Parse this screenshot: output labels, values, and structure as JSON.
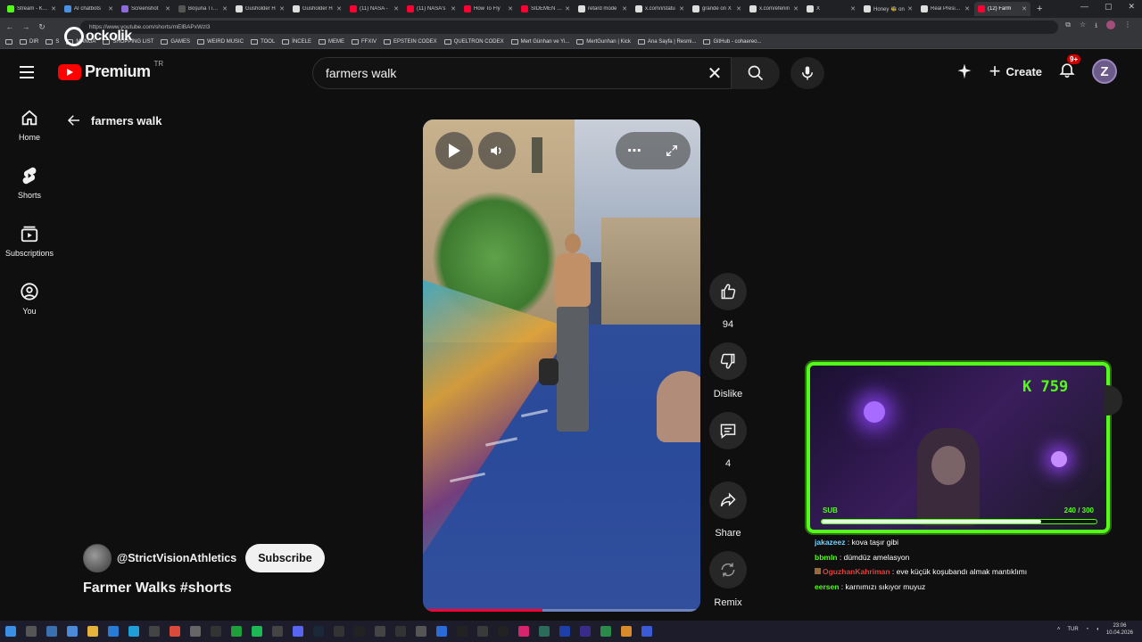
{
  "browser": {
    "tabs": [
      {
        "label": "Stream - Kick",
        "color": "#53fc18"
      },
      {
        "label": "AI chatbots",
        "color": "#4a90e2"
      },
      {
        "label": "Screenshot",
        "color": "#8e6bd8"
      },
      {
        "label": "Boşuna Tıklan",
        "color": "#555555"
      },
      {
        "label": "Gusholder H",
        "color": "#dddddd"
      },
      {
        "label": "Gusholder H",
        "color": "#dddddd"
      },
      {
        "label": "(11) NASA -",
        "color": "#ff0033"
      },
      {
        "label": "(11) NASA's",
        "color": "#ff0033"
      },
      {
        "label": "How To Fly",
        "color": "#ff0033"
      },
      {
        "label": "SIDEMEN CH",
        "color": "#ff0033"
      },
      {
        "label": "retard mode",
        "color": "#dddddd"
      },
      {
        "label": "x.com/i/statu",
        "color": "#dddddd"
      },
      {
        "label": "grande on X",
        "color": "#dddddd"
      },
      {
        "label": "x.com/efenin",
        "color": "#dddddd"
      },
      {
        "label": "X",
        "color": "#dddddd"
      },
      {
        "label": "Honey 🐝 on",
        "color": "#dddddd"
      },
      {
        "label": "Real Presiden",
        "color": "#dddddd"
      },
      {
        "label": "(12) Farm",
        "color": "#ff0033",
        "active": true
      }
    ],
    "url": "https://www.youtube.com/shorts/mElBAPxWzl3",
    "bookmarks": [
      "DIR",
      "S",
      "MANGA",
      "SHOPPING LIST",
      "GAMES",
      "WEIRD MUSIC",
      "TOOL",
      "İNCELE",
      "MEME",
      "FFXIV",
      "EPSTEIN CODEX",
      "QUELTRON CODEX",
      "Mert Günhan ve Yi...",
      "MertGunhan | Kick",
      "Ana Sayfa | Resmi...",
      "GitHub - cohaereo..."
    ],
    "watermark": "ockolik"
  },
  "header": {
    "logo_text": "Premium",
    "logo_region": "TR",
    "search_query": "farmers walk",
    "create_label": "Create",
    "notification_badge": "9+",
    "avatar_letter": "Z"
  },
  "sidebar": {
    "items": [
      {
        "label": "Home",
        "icon": "home-icon"
      },
      {
        "label": "Shorts",
        "icon": "shorts-icon"
      },
      {
        "label": "Subscriptions",
        "icon": "subscriptions-icon"
      },
      {
        "label": "You",
        "icon": "you-icon"
      }
    ]
  },
  "shorts": {
    "back_label": "farmers walk",
    "channel_name": "@StrictVisionAthletics",
    "subscribe_label": "Subscribe",
    "title": "Farmer Walks #shorts",
    "progress": 0.43,
    "actions": {
      "like_count": "94",
      "dislike_label": "Dislike",
      "comment_count": "4",
      "share_label": "Share",
      "remix_label": "Remix"
    }
  },
  "stream_overlay": {
    "kick_count": "759",
    "sub_label": "SUB",
    "sub_progress_text": "240 / 300",
    "sub_progress": 0.8,
    "accent": "#53fc18"
  },
  "chat": [
    {
      "user": "jakazeez",
      "color": "#6fd3ff",
      "msg": "kova taşır gibi",
      "badge": false
    },
    {
      "user": "bbmln",
      "color": "#53fc18",
      "msg": "dümdüz amelasyon",
      "badge": false
    },
    {
      "user": "OguzhanKahriman",
      "color": "#e0403a",
      "msg": "eve küçük koşubandı almak mantıklımı",
      "badge": true
    },
    {
      "user": "eersen",
      "color": "#53fc18",
      "msg": "karnımızı sıkıyor muyuz",
      "badge": false
    }
  ],
  "taskbar": {
    "language": "TUR",
    "time": "23:06",
    "date": "10.04.2026"
  }
}
